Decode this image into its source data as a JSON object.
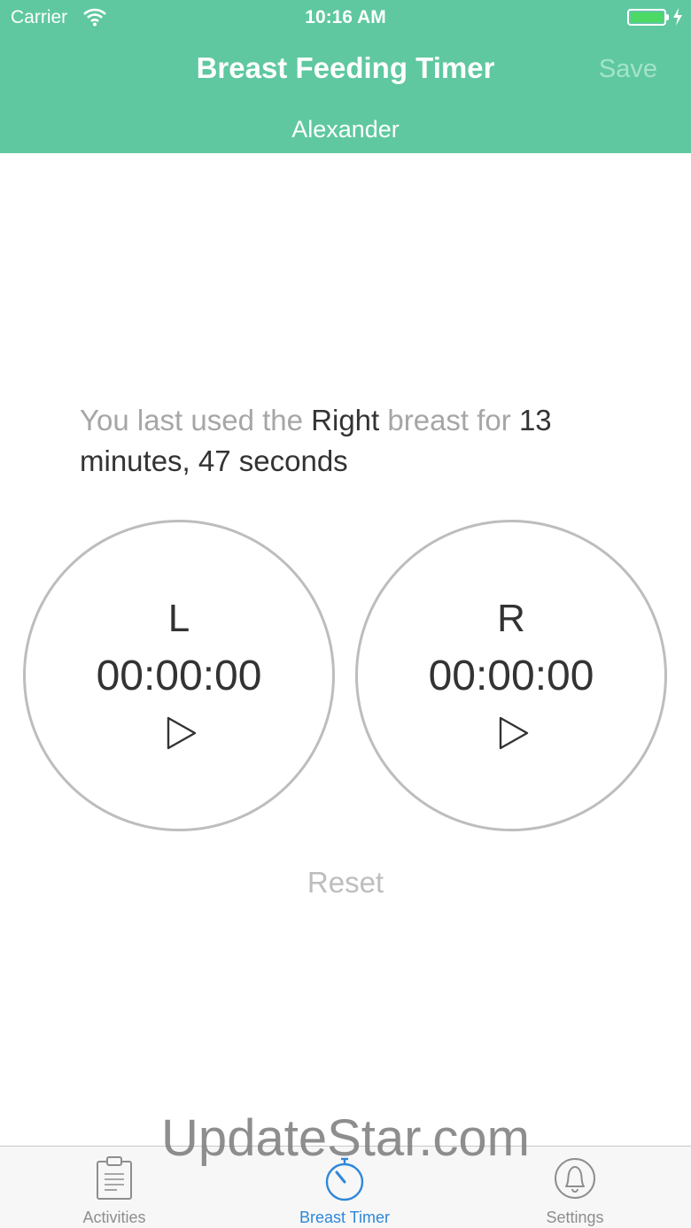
{
  "status_bar": {
    "carrier": "Carrier",
    "time": "10:16 AM"
  },
  "nav": {
    "title": "Breast Feeding Timer",
    "save_label": "Save",
    "subtitle": "Alexander"
  },
  "last_used": {
    "prefix": "You last used the ",
    "side": "Right",
    "middle": " breast for ",
    "duration": "13 minutes, 47 seconds"
  },
  "timers": {
    "left": {
      "side": "L",
      "time": "00:00:00"
    },
    "right": {
      "side": "R",
      "time": "00:00:00"
    }
  },
  "reset_label": "Reset",
  "watermark": "UpdateStar.com",
  "tabs": [
    {
      "label": "Activities",
      "icon": "clipboard-icon",
      "active": false
    },
    {
      "label": "Breast Timer",
      "icon": "stopwatch-icon",
      "active": true
    },
    {
      "label": "Settings",
      "icon": "bell-icon",
      "active": false
    }
  ],
  "colors": {
    "header": "#5fc8a0",
    "active_tab": "#2f87d9",
    "battery": "#4cd964"
  }
}
